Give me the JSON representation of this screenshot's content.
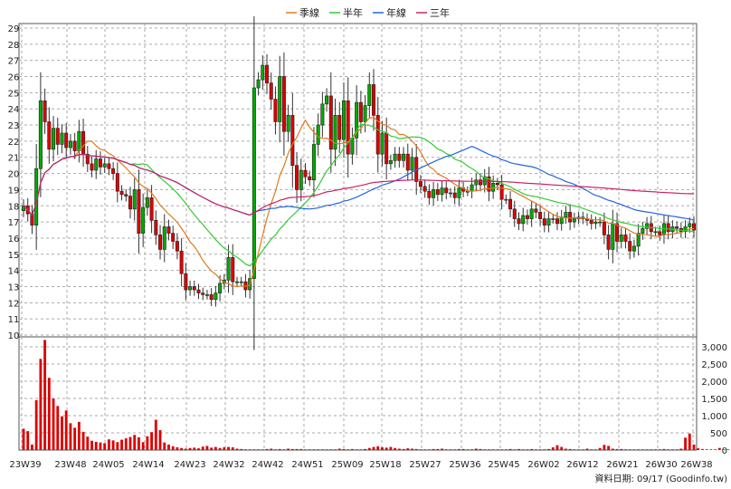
{
  "chart_data": {
    "type": "candlestick+volume",
    "title": "",
    "legend": [
      {
        "label": "季線",
        "color": "#e07a1f"
      },
      {
        "label": "半年",
        "color": "#33cc33"
      },
      {
        "label": "年線",
        "color": "#2266dd"
      },
      {
        "label": "三年",
        "color": "#cc2266"
      }
    ],
    "price_axis": {
      "min": 10,
      "max": 29,
      "ticks": [
        10,
        11,
        12,
        13,
        14,
        15,
        16,
        17,
        18,
        19,
        20,
        21,
        22,
        23,
        24,
        25,
        26,
        27,
        28,
        29
      ],
      "position": "left"
    },
    "volume_axis": {
      "min": 0,
      "max": 3000,
      "ticks": [
        "0",
        "500",
        "1,000",
        "1,500",
        "2,000",
        "2,500",
        "3,000"
      ],
      "tick_values": [
        0,
        500,
        1000,
        1500,
        2000,
        2500,
        3000
      ],
      "position": "right"
    },
    "x_labels": [
      "23W39",
      "23W48",
      "24W05",
      "24W14",
      "24W23",
      "24W32",
      "24W42",
      "24W51",
      "25W09",
      "25W18",
      "25W27",
      "25W36",
      "25W45",
      "26W02",
      "26W12",
      "26W21",
      "26W30",
      "26W38"
    ],
    "footer": "資料日期: 09/17  (Goodinfo.tw)",
    "grid": true,
    "up_color": "#00aa00",
    "down_color": "#dd0000",
    "volume_color": "#dd0000",
    "close": [
      18.0,
      17.5,
      16.8,
      20.3,
      24.5,
      23.2,
      21.5,
      22.8,
      21.8,
      22.5,
      21.6,
      22.0,
      21.4,
      22.6,
      21.2,
      20.6,
      20.2,
      20.9,
      20.4,
      20.6,
      20.3,
      20.0,
      18.9,
      18.7,
      18.6,
      17.8,
      19.0,
      16.3,
      17.9,
      18.5,
      17.1,
      16.2,
      15.3,
      16.7,
      16.3,
      15.8,
      15.2,
      13.8,
      12.8,
      13.0,
      12.8,
      12.6,
      12.5,
      12.5,
      12.2,
      12.6,
      13.2,
      13.4,
      14.8,
      13.3,
      13.3,
      13.3,
      12.8,
      13.5,
      25.3,
      25.8,
      26.7,
      25.6,
      24.6,
      23.2,
      26.0,
      22.6,
      23.6,
      20.5,
      19.0,
      20.2,
      19.8,
      19.6,
      21.8,
      23.0,
      24.3,
      24.8,
      21.5,
      23.6,
      22.1,
      24.5,
      21.2,
      22.2,
      24.4,
      23.2,
      24.2,
      25.5,
      23.6,
      21.2,
      22.5,
      20.6,
      20.8,
      21.2,
      20.8,
      21.2,
      20.2,
      21.0,
      19.5,
      19.2,
      18.9,
      18.5,
      19.0,
      18.7,
      19.1,
      18.8,
      18.8,
      18.5,
      19.1,
      18.9,
      18.9,
      19.3,
      19.6,
      19.3,
      19.8,
      18.9,
      19.4,
      19.3,
      18.4,
      18.4,
      17.8,
      17.2,
      16.9,
      17.4,
      17.2,
      17.8,
      17.6,
      17.2,
      16.8,
      17.2,
      17.2,
      16.9,
      17.3,
      17.6,
      17.0,
      17.2,
      17.3,
      17.2,
      17.1,
      16.9,
      17.0,
      17.0,
      16.2,
      15.3,
      16.9,
      15.8,
      16.2,
      15.8,
      15.2,
      15.5,
      16.3,
      16.6,
      16.9,
      16.4,
      16.4,
      16.2,
      16.9,
      16.4,
      16.7,
      16.6,
      16.4,
      16.7,
      16.9,
      16.5
    ],
    "volume": [
      620,
      550,
      160,
      1450,
      2650,
      3200,
      2100,
      1500,
      1280,
      980,
      1150,
      780,
      650,
      820,
      530,
      390,
      270,
      240,
      220,
      200,
      310,
      280,
      230,
      300,
      340,
      380,
      440,
      370,
      230,
      400,
      520,
      880,
      580,
      220,
      160,
      110,
      80,
      60,
      40,
      60,
      70,
      50,
      100,
      120,
      70,
      90,
      60,
      80,
      90,
      80,
      40,
      30,
      20,
      20,
      20,
      20,
      20,
      30,
      40,
      20,
      30,
      20,
      40,
      30,
      30,
      30,
      20,
      20,
      20,
      20,
      20,
      20,
      20,
      20,
      40,
      30,
      20,
      30,
      20,
      20,
      30,
      60,
      90,
      110,
      80,
      70,
      90,
      60,
      40,
      30,
      50,
      40,
      30,
      20,
      20,
      20,
      30,
      30,
      40,
      20,
      20,
      20,
      30,
      30,
      20,
      20,
      40,
      30,
      20,
      20,
      20,
      20,
      20,
      20,
      30,
      20,
      30,
      20,
      20,
      30,
      20,
      20,
      20,
      30,
      80,
      140,
      90,
      40,
      30,
      20,
      20,
      20,
      40,
      20,
      20,
      60,
      150,
      120,
      40,
      30,
      30,
      20,
      20,
      20,
      20,
      20,
      20,
      20,
      20,
      20,
      30,
      20,
      20,
      20,
      40,
      360,
      480,
      160,
      50,
      30,
      20,
      20,
      20,
      60,
      20,
      20,
      20,
      30
    ]
  }
}
